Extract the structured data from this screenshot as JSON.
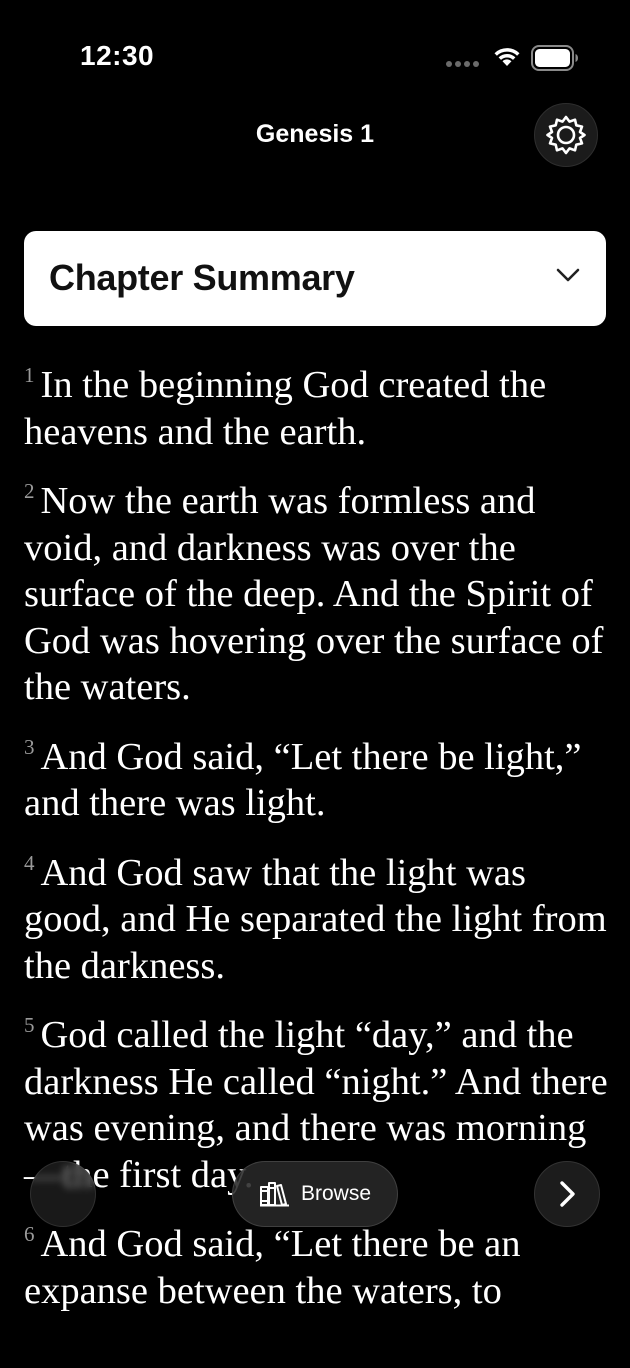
{
  "status_bar": {
    "time": "12:30",
    "icons": [
      "signal-icon",
      "wifi-icon",
      "battery-icon"
    ]
  },
  "header": {
    "title": "Genesis 1",
    "settings_icon": "gear-icon"
  },
  "summary": {
    "title": "Chapter Summary",
    "icon": "chevron-down-icon"
  },
  "verses": [
    {
      "num": "1",
      "text": "In the beginning God created the heavens and the earth."
    },
    {
      "num": "2",
      "text": "Now the earth was formless and void, and darkness was over the surface of the deep. And the Spirit of God was hovering over the surface of the waters."
    },
    {
      "num": "3",
      "text": "And God said, “Let there be light,” and there was light."
    },
    {
      "num": "4",
      "text": "And God saw that the light was good, and He separated the light from the darkness."
    },
    {
      "num": "5",
      "text": "God called the light “day,” and the darkness He called “night.” And there was evening, and there was morning—the first day."
    },
    {
      "num": "6",
      "text": "And God said, “Let there be an expanse between the waters, to"
    }
  ],
  "controls": {
    "browse_label": "Browse",
    "browse_icon": "books-icon",
    "next_icon": "chevron-right-icon"
  },
  "colors": {
    "background": "#000000",
    "text": "#ffffff",
    "verse_number": "#9a9a9a",
    "card": "#ffffff"
  }
}
